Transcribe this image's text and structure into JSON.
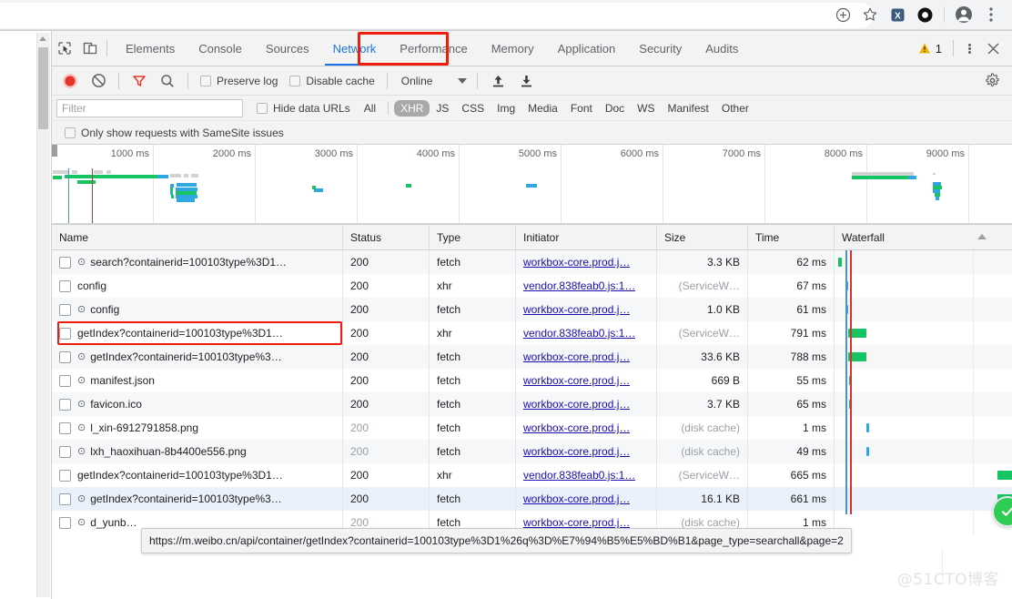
{
  "browser": {
    "icons": [
      {
        "name": "install-app-icon",
        "glyph": "⊕"
      },
      {
        "name": "bookmark-star-icon",
        "glyph": "☆"
      },
      {
        "name": "extension-x-icon",
        "glyph": "X"
      },
      {
        "name": "extension-circle-icon",
        "glyph": "O"
      },
      {
        "name": "profile-avatar-icon",
        "glyph": "person"
      },
      {
        "name": "chrome-menu-icon",
        "glyph": "⋮"
      }
    ]
  },
  "devtools": {
    "tabs": [
      {
        "label": "Elements",
        "active": false
      },
      {
        "label": "Console",
        "active": false
      },
      {
        "label": "Sources",
        "active": false
      },
      {
        "label": "Network",
        "active": true
      },
      {
        "label": "Performance",
        "active": false
      },
      {
        "label": "Memory",
        "active": false
      },
      {
        "label": "Application",
        "active": false
      },
      {
        "label": "Security",
        "active": false
      },
      {
        "label": "Audits",
        "active": false
      }
    ],
    "warning_count": "1",
    "toolbar": {
      "record_title": "record",
      "clear_title": "clear",
      "filter_title": "filter",
      "search_title": "search",
      "preserve_log": "Preserve log",
      "disable_cache": "Disable cache",
      "throttle_value": "Online",
      "import_title": "import-har",
      "export_title": "export-har",
      "settings_title": "settings"
    },
    "filter": {
      "placeholder": "Filter",
      "value": "",
      "hide_data_urls": "Hide data URLs",
      "types": [
        {
          "label": "All",
          "selected": false
        },
        {
          "label": "XHR",
          "selected": true
        },
        {
          "label": "JS",
          "selected": false
        },
        {
          "label": "CSS",
          "selected": false
        },
        {
          "label": "Img",
          "selected": false
        },
        {
          "label": "Media",
          "selected": false
        },
        {
          "label": "Font",
          "selected": false
        },
        {
          "label": "Doc",
          "selected": false
        },
        {
          "label": "WS",
          "selected": false
        },
        {
          "label": "Manifest",
          "selected": false
        },
        {
          "label": "Other",
          "selected": false
        }
      ]
    },
    "samesite_label": "Only show requests with SameSite issues"
  },
  "overview": {
    "ticks": [
      "1000 ms",
      "2000 ms",
      "3000 ms",
      "4000 ms",
      "5000 ms",
      "6000 ms",
      "7000 ms",
      "8000 ms",
      "9000 ms"
    ]
  },
  "table": {
    "headers": [
      "Name",
      "Status",
      "Type",
      "Initiator",
      "Size",
      "Time",
      "Waterfall"
    ],
    "rows": [
      {
        "name": "search?containerid=100103type%3D1…",
        "sw": true,
        "status": "200",
        "type": "fetch",
        "initiator": "workbox-core.prod.j…",
        "size": "3.3 KB",
        "time": "62 ms",
        "muted_status": false,
        "muted_size": false
      },
      {
        "name": "config",
        "sw": false,
        "status": "200",
        "type": "xhr",
        "initiator": "vendor.838feab0.js:1…",
        "size": "(ServiceW…",
        "time": "67 ms",
        "muted_status": false,
        "muted_size": true
      },
      {
        "name": "config",
        "sw": true,
        "status": "200",
        "type": "fetch",
        "initiator": "workbox-core.prod.j…",
        "size": "1.0 KB",
        "time": "61 ms",
        "muted_status": false,
        "muted_size": false
      },
      {
        "name": "getIndex?containerid=100103type%3D1…",
        "sw": false,
        "status": "200",
        "type": "xhr",
        "initiator": "vendor.838feab0.js:1…",
        "size": "(ServiceW…",
        "time": "791 ms",
        "muted_status": false,
        "muted_size": true
      },
      {
        "name": "getIndex?containerid=100103type%3…",
        "sw": true,
        "status": "200",
        "type": "fetch",
        "initiator": "workbox-core.prod.j…",
        "size": "33.6 KB",
        "time": "788 ms",
        "muted_status": false,
        "muted_size": false
      },
      {
        "name": "manifest.json",
        "sw": true,
        "status": "200",
        "type": "fetch",
        "initiator": "workbox-core.prod.j…",
        "size": "669 B",
        "time": "55 ms",
        "muted_status": false,
        "muted_size": false
      },
      {
        "name": "favicon.ico",
        "sw": true,
        "status": "200",
        "type": "fetch",
        "initiator": "workbox-core.prod.j…",
        "size": "3.7 KB",
        "time": "65 ms",
        "muted_status": false,
        "muted_size": false
      },
      {
        "name": "l_xin-6912791858.png",
        "sw": true,
        "status": "200",
        "type": "fetch",
        "initiator": "workbox-core.prod.j…",
        "size": "(disk cache)",
        "time": "1 ms",
        "muted_status": true,
        "muted_size": true
      },
      {
        "name": "lxh_haoxihuan-8b4400e556.png",
        "sw": true,
        "status": "200",
        "type": "fetch",
        "initiator": "workbox-core.prod.j…",
        "size": "(disk cache)",
        "time": "49 ms",
        "muted_status": true,
        "muted_size": true
      },
      {
        "name": "getIndex?containerid=100103type%3D1…",
        "sw": false,
        "status": "200",
        "type": "xhr",
        "initiator": "vendor.838feab0.js:1…",
        "size": "(ServiceW…",
        "time": "665 ms",
        "muted_status": false,
        "muted_size": true
      },
      {
        "name": "getIndex?containerid=100103type%3…",
        "sw": true,
        "status": "200",
        "type": "fetch",
        "initiator": "workbox-core.prod.j…",
        "size": "16.1 KB",
        "time": "661 ms",
        "muted_status": false,
        "muted_size": false
      },
      {
        "name": "d_yunb…",
        "sw": true,
        "status": "200",
        "type": "fetch",
        "initiator": "workbox-core.prod.j…",
        "size": "(disk cache)",
        "time": "1 ms",
        "muted_status": true,
        "muted_size": true
      }
    ]
  },
  "tooltip": {
    "url": "https://m.weibo.cn/api/container/getIndex?containerid=100103type%3D1%26q%3D%E7%94%B5%E5%BD%B1&page_type=searchall&page=2"
  },
  "watermark": "@51CTO博客",
  "colors": {
    "accent": "#1a73e8",
    "annotation": "#f01c0c",
    "waterfall_green": "#16c464",
    "waterfall_blue": "#2fa8e0",
    "badge_green": "#2ecc55"
  }
}
